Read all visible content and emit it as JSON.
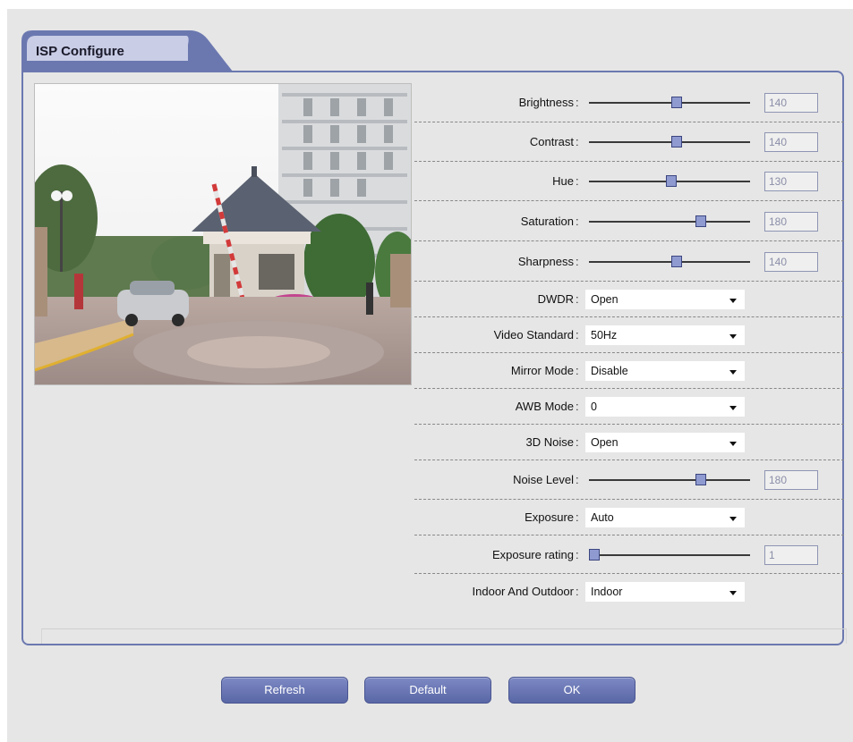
{
  "tab": {
    "title": "ISP Configure"
  },
  "settings": [
    {
      "label": "Brightness",
      "type": "slider",
      "value": "140",
      "level": 0.55
    },
    {
      "label": "Contrast",
      "type": "slider",
      "value": "140",
      "level": 0.55
    },
    {
      "label": "Hue",
      "type": "slider",
      "value": "130",
      "level": 0.51
    },
    {
      "label": "Saturation",
      "type": "slider",
      "value": "180",
      "level": 0.71
    },
    {
      "label": "Sharpness",
      "type": "slider",
      "value": "140",
      "level": 0.55
    },
    {
      "label": "DWDR",
      "type": "select",
      "value": "Open"
    },
    {
      "label": "Video Standard",
      "type": "select",
      "value": "50Hz"
    },
    {
      "label": "Mirror Mode",
      "type": "select",
      "value": "Disable"
    },
    {
      "label": "AWB Mode",
      "type": "select",
      "value": "0"
    },
    {
      "label": "3D Noise",
      "type": "select",
      "value": "Open"
    },
    {
      "label": "Noise Level",
      "type": "slider",
      "value": "180",
      "level": 0.71
    },
    {
      "label": "Exposure",
      "type": "select",
      "value": "Auto"
    },
    {
      "label": "Exposure rating",
      "type": "slider",
      "value": "1",
      "level": 0.0
    },
    {
      "label": "Indoor And Outdoor",
      "type": "select",
      "value": "Indoor"
    }
  ],
  "colon": ":",
  "buttons": {
    "refresh": "Refresh",
    "default": "Default",
    "ok": "OK"
  },
  "colors": {
    "accent": "#6b78b0",
    "button": "#6a77b6",
    "thumb": "#8f9bd0"
  }
}
